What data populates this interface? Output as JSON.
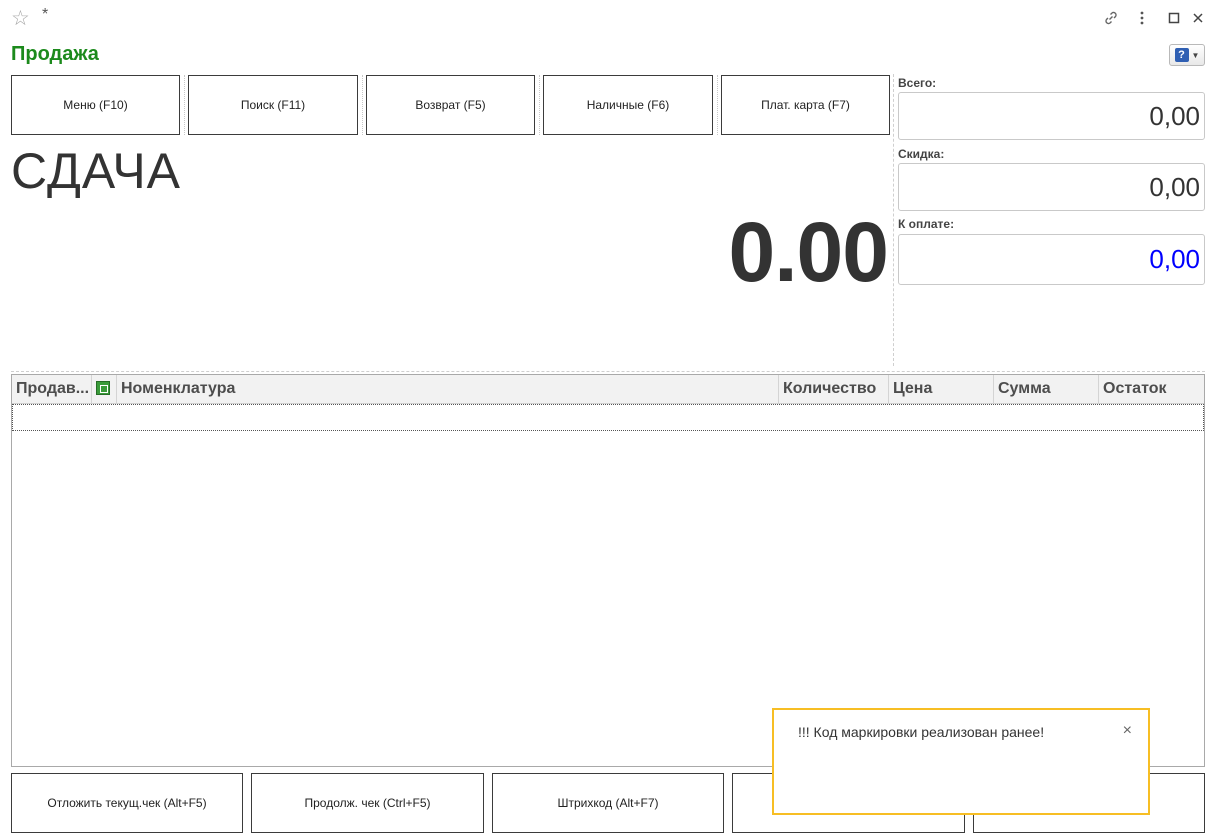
{
  "window": {
    "modified_mark": "*",
    "title": "Продажа"
  },
  "buttons_top": {
    "menu": "Меню (F10)",
    "search": "Поиск (F11)",
    "return": "Возврат (F5)",
    "cash": "Наличные (F6)",
    "card": "Плат. карта (F7)"
  },
  "change": {
    "label": "СДАЧА",
    "value": "0.00"
  },
  "totals": {
    "total_label": "Всего:",
    "total_value": "0,00",
    "discount_label": "Скидка:",
    "discount_value": "0,00",
    "to_pay_label": "К оплате:",
    "to_pay_value": "0,00",
    "to_pay_color": "#0000ff"
  },
  "table": {
    "columns": [
      "Продав...",
      "",
      "Номенклатура",
      "Количество",
      "Цена",
      "Сумма",
      "Остаток"
    ],
    "rows": []
  },
  "buttons_bottom": {
    "defer": "Отложить текущ.чек (Alt+F5)",
    "continue": "Продолж. чек (Ctrl+F5)",
    "barcode": "Штрихкод (Alt+F7)"
  },
  "notification": {
    "text": "!!! Код маркировки реализован ранее!",
    "border_color": "#f7be24"
  },
  "colors": {
    "title": "#1c8a1c"
  }
}
